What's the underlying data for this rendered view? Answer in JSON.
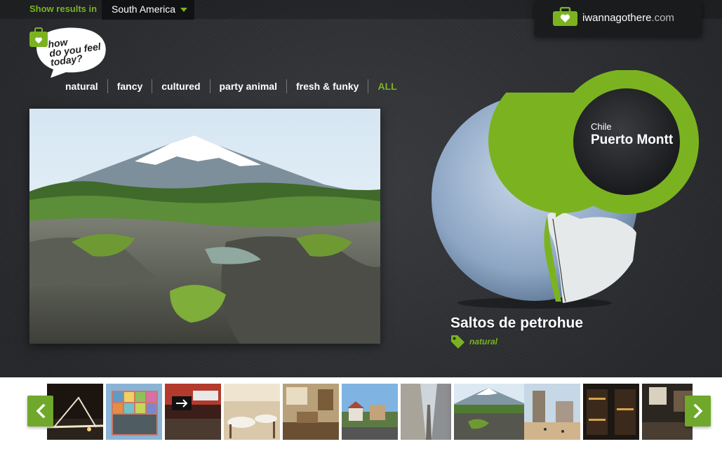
{
  "topbar": {
    "show_label": "Show results in",
    "region": "South America"
  },
  "brand": {
    "name": "iwannagothere",
    "domain": ".com"
  },
  "logo": {
    "line1": "how",
    "line2": "do you feel",
    "line3": "today?"
  },
  "moods": [
    "natural",
    "fancy",
    "cultured",
    "party animal",
    "fresh & funky",
    "ALL"
  ],
  "location": {
    "country": "Chile",
    "city": "Puerto Montt"
  },
  "place": {
    "name": "Saltos de petrohue",
    "tag": "natural"
  },
  "colors": {
    "accent": "#7bb320",
    "pin_dark": "#1e1f22",
    "globe": "#8fa7c6"
  },
  "thumbnails": [
    {
      "scene": "bridge-night"
    },
    {
      "scene": "colorful-building"
    },
    {
      "scene": "city-street-sign"
    },
    {
      "scene": "restaurant-interior"
    },
    {
      "scene": "cafe-interior"
    },
    {
      "scene": "hillside-houses"
    },
    {
      "scene": "narrow-alley"
    },
    {
      "scene": "volcano-waterfall",
      "active": true
    },
    {
      "scene": "beach-tower"
    },
    {
      "scene": "shop-display"
    },
    {
      "scene": "bar-interior"
    }
  ]
}
